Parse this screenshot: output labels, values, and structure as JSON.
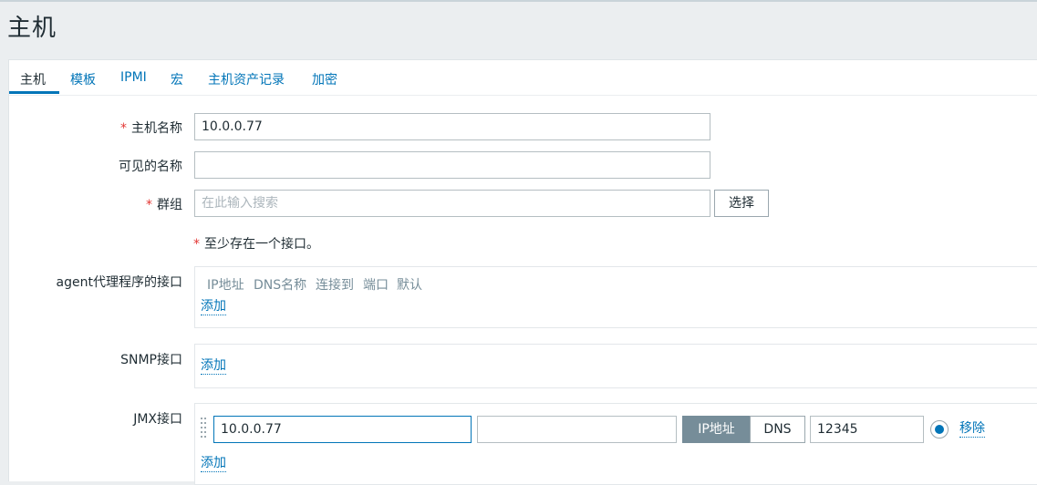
{
  "page": {
    "title": "主机"
  },
  "tabs": [
    "主机",
    "模板",
    "IPMI",
    "宏",
    "主机资产记录",
    "加密"
  ],
  "form": {
    "host_name": {
      "label": "主机名称",
      "value": "10.0.0.77"
    },
    "visible_name": {
      "label": "可见的名称",
      "value": ""
    },
    "groups": {
      "label": "群组",
      "placeholder": "在此输入搜索",
      "select_label": "选择"
    },
    "required_mark": "*",
    "interface_note": "至少存在一个接口。",
    "agent": {
      "label": "agent代理程序的接口",
      "columns": [
        "IP地址",
        "DNS名称",
        "连接到",
        "端口",
        "默认"
      ],
      "add_label": "添加"
    },
    "snmp": {
      "label": "SNMP接口",
      "add_label": "添加"
    },
    "jmx": {
      "label": "JMX接口",
      "ip_value": "10.0.0.77",
      "dns_value": "",
      "connect_options": [
        "IP地址",
        "DNS"
      ],
      "connect_selected": "IP地址",
      "port_value": "12345",
      "default_selected": true,
      "remove_label": "移除",
      "add_label": "添加"
    }
  },
  "colors": {
    "accent": "#0275b8",
    "required": "#e33734",
    "segment_active": "#768d99"
  }
}
